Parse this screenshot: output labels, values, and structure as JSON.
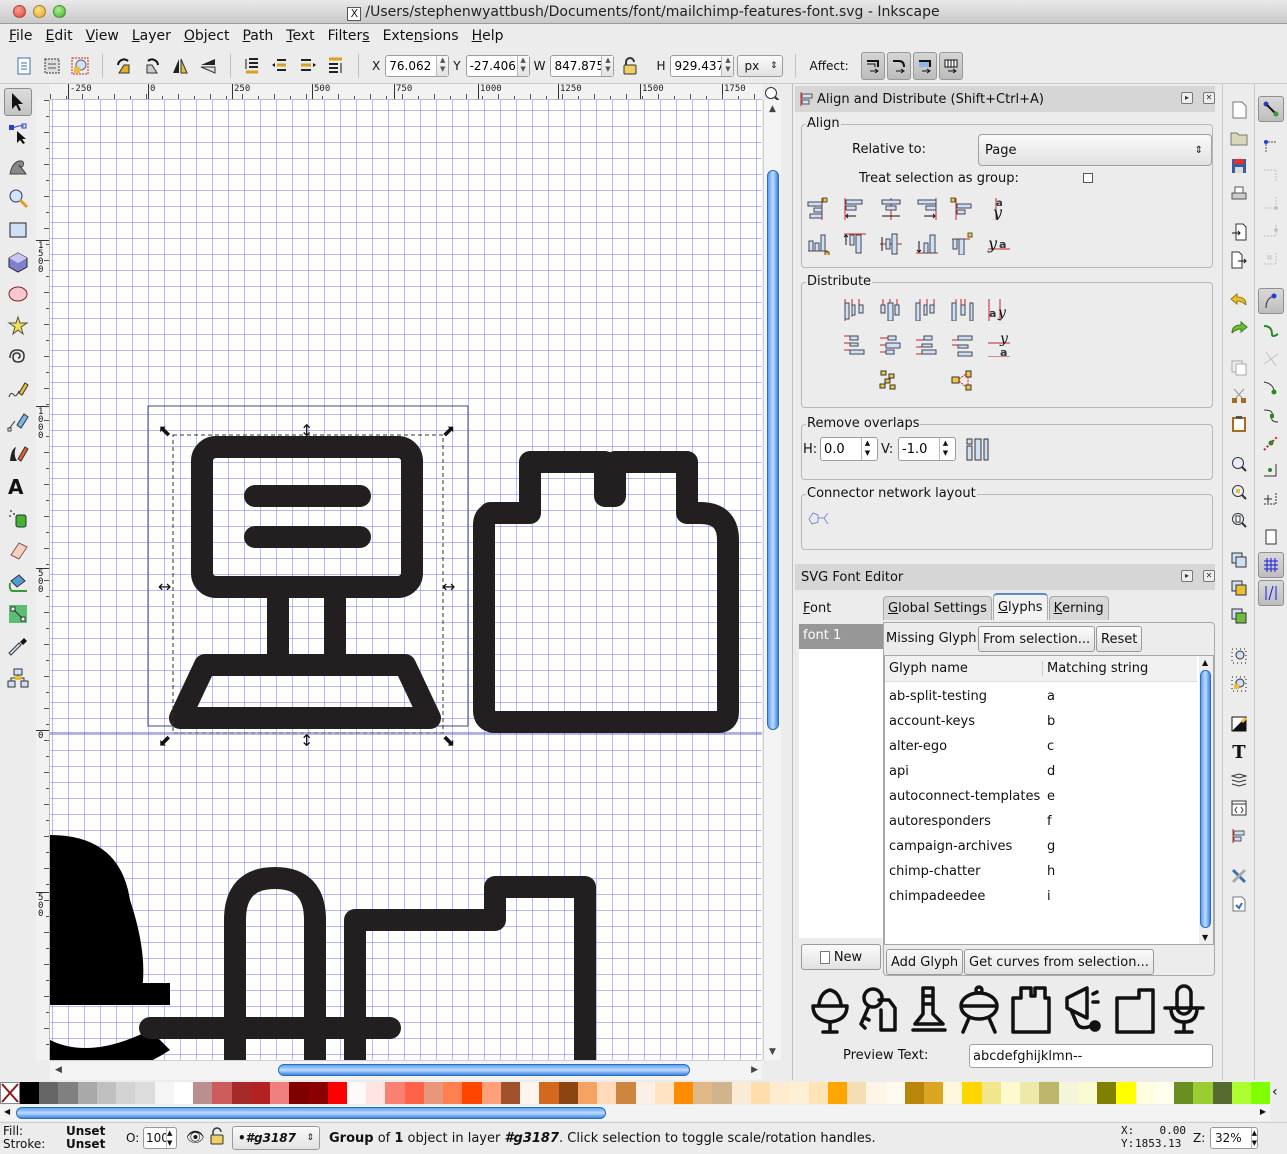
{
  "window": {
    "title": "/Users/stephenwyattbush/Documents/font/mailchimp-features-font.svg - Inkscape"
  },
  "menu": [
    {
      "label": "File",
      "mnemonic": "F"
    },
    {
      "label": "Edit",
      "mnemonic": "E"
    },
    {
      "label": "View",
      "mnemonic": "V"
    },
    {
      "label": "Layer",
      "mnemonic": "L"
    },
    {
      "label": "Object",
      "mnemonic": "O"
    },
    {
      "label": "Path",
      "mnemonic": "P"
    },
    {
      "label": "Text",
      "mnemonic": "T"
    },
    {
      "label": "Filters",
      "mnemonic": "s"
    },
    {
      "label": "Extensions",
      "mnemonic": "n"
    },
    {
      "label": "Help",
      "mnemonic": "H"
    }
  ],
  "toolbar": {
    "x_label": "X",
    "x_value": "76.062",
    "y_label": "Y",
    "y_value": "-27.406",
    "w_label": "W",
    "w_value": "847.875",
    "h_label": "H",
    "h_value": "929.437",
    "unit": "px",
    "affect_label": "Affect:",
    "buttons": [
      "select-all-icon",
      "select-all-in-all-layers-icon",
      "deselect-icon",
      "rotate-ccw-icon",
      "rotate-cw-icon",
      "flip-horizontal-icon",
      "flip-vertical-icon",
      "lower-to-bottom-icon",
      "lower-icon",
      "raise-icon",
      "raise-to-top-icon"
    ],
    "affect_buttons": [
      "scale-stroke-icon",
      "scale-rounded-corners-icon",
      "move-gradients-icon",
      "move-patterns-icon"
    ]
  },
  "tools": [
    {
      "name": "selector-tool",
      "active": true
    },
    {
      "name": "node-tool"
    },
    {
      "name": "tweak-tool"
    },
    {
      "name": "zoom-tool"
    },
    {
      "name": "rectangle-tool"
    },
    {
      "name": "3d-box-tool"
    },
    {
      "name": "ellipse-tool"
    },
    {
      "name": "star-tool"
    },
    {
      "name": "spiral-tool"
    },
    {
      "name": "pencil-tool"
    },
    {
      "name": "pen-tool"
    },
    {
      "name": "calligraphy-tool"
    },
    {
      "name": "text-tool"
    },
    {
      "name": "spray-tool"
    },
    {
      "name": "eraser-tool"
    },
    {
      "name": "paint-bucket-tool"
    },
    {
      "name": "gradient-tool"
    },
    {
      "name": "dropper-tool"
    },
    {
      "name": "connector-tool"
    }
  ],
  "rulers": {
    "horizontal": [
      "-250",
      "0",
      "250",
      "500",
      "750",
      "1000",
      "1250",
      "1500",
      "1750"
    ],
    "vertical": [
      "1500",
      "1000",
      "500",
      "0",
      "500"
    ]
  },
  "align_dialog": {
    "title": "Align and Distribute (Shift+Ctrl+A)",
    "align_label": "Align",
    "relative_to_label": "Relative to:",
    "relative_to_value": "Page",
    "treat_as_group_label": "Treat selection as group:",
    "treat_as_group_checked": false,
    "distribute_label": "Distribute",
    "remove_overlaps_label": "Remove overlaps",
    "h_label": "H:",
    "h_value": "0.0",
    "v_label": "V:",
    "v_value": "-1.0",
    "connector_label": "Connector network layout"
  },
  "font_editor": {
    "title": "SVG Font Editor",
    "font_column_label": "Font",
    "fonts": [
      "font 1"
    ],
    "tabs": [
      {
        "label": "Global Settings",
        "active": false
      },
      {
        "label": "Glyphs",
        "active": true
      },
      {
        "label": "Kerning",
        "active": false
      }
    ],
    "missing_glyph_label": "Missing Glyph:",
    "from_selection_label": "From selection...",
    "reset_label": "Reset",
    "columns": [
      "Glyph name",
      "Matching string"
    ],
    "glyphs": [
      {
        "name": "ab-split-testing",
        "match": "a"
      },
      {
        "name": "account-keys",
        "match": "b"
      },
      {
        "name": "alter-ego",
        "match": "c"
      },
      {
        "name": "api",
        "match": "d"
      },
      {
        "name": "autoconnect-templates",
        "match": "e"
      },
      {
        "name": "autoresponders",
        "match": "f"
      },
      {
        "name": "campaign-archives",
        "match": "g"
      },
      {
        "name": "chimp-chatter",
        "match": "h"
      },
      {
        "name": "chimpadeedee",
        "match": "i"
      }
    ],
    "new_label": "New",
    "add_glyph_label": "Add Glyph",
    "get_curves_label": "Get curves from selection...",
    "preview_glyphs": [
      "sundae-icon",
      "keys-icon",
      "flask-icon",
      "grill-icon",
      "block-icon",
      "megaphone-icon",
      "folder-icon",
      "microphone-icon"
    ],
    "preview_text_label": "Preview Text:",
    "preview_text_value": "abcdefghijklmn--"
  },
  "palette": [
    "#000000",
    "#666666",
    "#808080",
    "#a9a9a9",
    "#c0c0c0",
    "#d3d3d3",
    "#dcdcdc",
    "#f5f5f5",
    "#ffffff",
    "#bc8f8f",
    "#cd5c5c",
    "#a52a2a",
    "#b22222",
    "#f08080",
    "#800000",
    "#8b0000",
    "#ff0000",
    "#fffafa",
    "#ffe4e1",
    "#fa8072",
    "#ff6347",
    "#e9967a",
    "#ff7f50",
    "#ff4500",
    "#ffa07a",
    "#a0522d",
    "#fff5ee",
    "#d2691e",
    "#8b4513",
    "#f4a460",
    "#ffdab9",
    "#cd853f",
    "#faf0e6",
    "#ffe4c4",
    "#ff8c00",
    "#deb887",
    "#d2b48c",
    "#faebd7",
    "#ffdead",
    "#ffebcd",
    "#ffefd5",
    "#ffe4b5",
    "#ffa500",
    "#f5deb3",
    "#fdf5e6",
    "#fffaf0",
    "#b8860b",
    "#daa520",
    "#fff8dc",
    "#ffd700",
    "#f0e68c",
    "#fffacd",
    "#eee8aa",
    "#bdb76b",
    "#f5f5dc",
    "#fafad2",
    "#808000",
    "#ffff00",
    "#ffffe0",
    "#fffff0",
    "#6b8e23",
    "#9acd32",
    "#556b2f",
    "#adff2f",
    "#7fff00"
  ],
  "status": {
    "fill_label": "Fill:",
    "fill_value": "Unset",
    "stroke_label": "Stroke:",
    "stroke_value": "Unset",
    "opacity_label": "O:",
    "opacity_value": "100",
    "layer_value": "•#g3187",
    "message_bold1": "Group",
    "message_part1": " of ",
    "message_bold2": "1",
    "message_part2": " object in layer ",
    "message_bold3": "#g3187",
    "message_part3": ". Click selection to toggle scale/rotation handles.",
    "x_label": "X:",
    "x_value": "0.00",
    "y_label": "Y:",
    "y_value": "1853.13",
    "zoom_label": "Z:",
    "zoom_value": "32%"
  }
}
